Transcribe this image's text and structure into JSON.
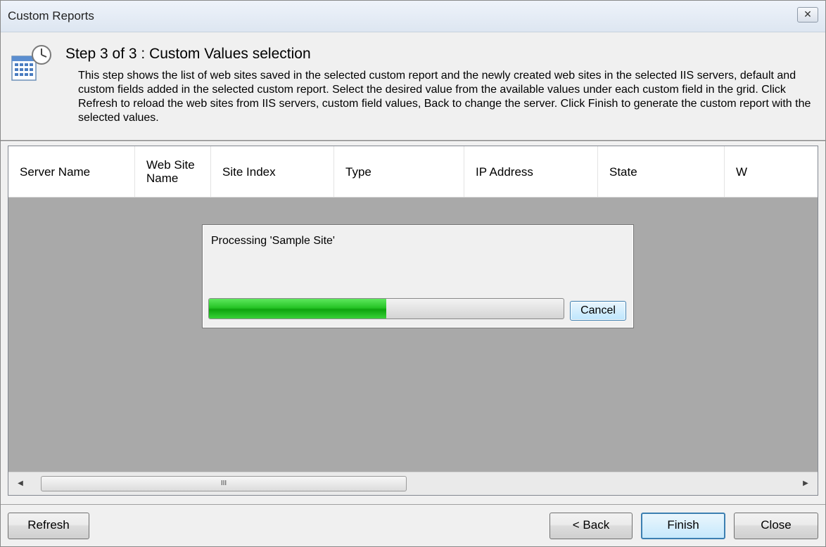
{
  "window": {
    "title": "Custom Reports",
    "close_glyph": "✕"
  },
  "header": {
    "step_title": "Step 3 of 3 : Custom Values selection",
    "description": "This step shows the list of web sites saved in the selected custom report and the newly created web sites in the selected IIS servers, default and custom fields added in the selected custom report. Select the desired value from the available values under each custom field in the grid. Click Refresh to reload the web sites from IIS servers, custom field values, Back to change the server. Click Finish to generate the custom report with the selected values.",
    "icon": "calendar-clock-icon"
  },
  "grid": {
    "columns": [
      {
        "label": "Server Name"
      },
      {
        "label": "Web Site Name"
      },
      {
        "label": "Site Index"
      },
      {
        "label": "Type"
      },
      {
        "label": "IP Address"
      },
      {
        "label": "State"
      },
      {
        "label": "W"
      }
    ],
    "scroll_left": "◀",
    "scroll_right": "▶",
    "scroll_grip": "III"
  },
  "progress": {
    "message": "Processing 'Sample Site'",
    "percent": 50,
    "cancel_label": "Cancel"
  },
  "footer": {
    "refresh_label": "Refresh",
    "back_label": "< Back",
    "finish_label": "Finish",
    "close_label": "Close"
  },
  "colors": {
    "grid_background": "#a9a9a9",
    "progress_fill": "#26c426",
    "primary_border": "#3c7fb1"
  }
}
